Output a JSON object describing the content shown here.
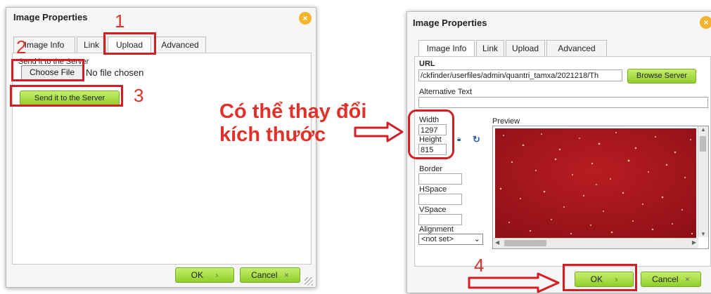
{
  "left_dialog": {
    "title": "Image Properties",
    "tabs": [
      "Image Info",
      "Link",
      "Upload",
      "Advanced"
    ],
    "active_tab": "Upload",
    "send_label": "Send it to the Server",
    "choose_file_label": "Choose File",
    "no_file_text": "No file chosen",
    "send_button": "Send it to the Server",
    "ok_label": "OK",
    "cancel_label": "Cancel"
  },
  "right_dialog": {
    "title": "Image Properties",
    "tabs": [
      "Image Info",
      "Link",
      "Upload",
      "Advanced"
    ],
    "active_tab": "Image Info",
    "url_label": "URL",
    "url_value": "/ckfinder/userfiles/admin/quantri_tamxa/2021218/Th",
    "browse_button": "Browse Server",
    "alt_label": "Alternative Text",
    "alt_value": "",
    "width_label": "Width",
    "width_value": "1297",
    "height_label": "Height",
    "height_value": "815",
    "preview_label": "Preview",
    "border_label": "Border",
    "hspace_label": "HSpace",
    "vspace_label": "VSpace",
    "alignment_label": "Alignment",
    "alignment_value": "<not set>",
    "ok_label": "OK",
    "cancel_label": "Cancel"
  },
  "annotations": {
    "step1": "1",
    "step2": "2",
    "step3": "3",
    "step4": "4",
    "note_line1": "Có thể thay đổi",
    "note_line2": "kích thước"
  },
  "colors": {
    "annotation_red": "#d21f26",
    "button_green": "#9bd633",
    "close_orange": "#f7b32b",
    "preview_red": "#a8141c"
  }
}
